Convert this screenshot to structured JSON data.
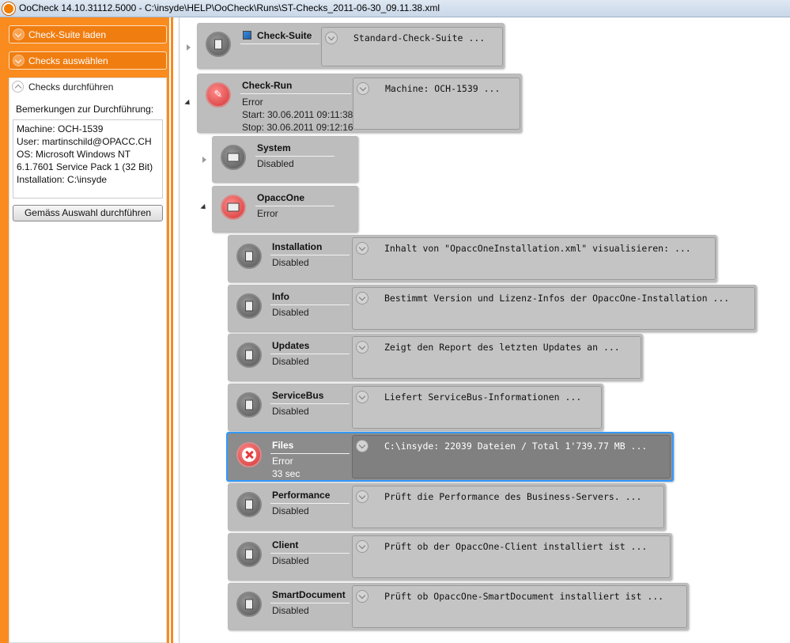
{
  "window": {
    "title": "OoCheck 14.10.31112.5000 - C:\\insyde\\HELP\\OoCheck\\Runs\\ST-Checks_2011-06-30_09.11.38.xml"
  },
  "sidebar": {
    "load_suite": "Check-Suite laden",
    "select_checks": "Checks auswählen",
    "run_checks": "Checks durchführen",
    "remarks_label": "Bemerkungen zur Durchführung:",
    "remarks_lines": [
      "Machine: OCH-1539",
      "User: martinschild@OPACC.CH",
      "OS: Microsoft Windows NT",
      "6.1.7601 Service Pack 1 (32 Bit)",
      "Installation: C:\\insyde"
    ],
    "run_button": "Gemäss Auswahl durchführen"
  },
  "tree": {
    "suite": {
      "name": "Check-Suite",
      "desc": "Standard-Check-Suite ..."
    },
    "run": {
      "name": "Check-Run",
      "status": "Error",
      "start": "Start: 30.06.2011 09:11:38",
      "stop": "Stop: 30.06.2011 09:12:16",
      "desc": "Machine: OCH-1539 ..."
    },
    "system": {
      "name": "System",
      "status": "Disabled"
    },
    "opaccone": {
      "name": "OpaccOne",
      "status": "Error"
    },
    "checks": [
      {
        "name": "Installation",
        "status": "Disabled",
        "desc": "Inhalt von \"OpaccOneInstallation.xml\" visualisieren: ..."
      },
      {
        "name": "Info",
        "status": "Disabled",
        "desc": "Bestimmt Version und Lizenz-Infos der OpaccOne-Installation ..."
      },
      {
        "name": "Updates",
        "status": "Disabled",
        "desc": "Zeigt den Report des letzten Updates an ..."
      },
      {
        "name": "ServiceBus",
        "status": "Disabled",
        "desc": "Liefert ServiceBus-Informationen ..."
      },
      {
        "name": "Files",
        "status": "Error",
        "duration": "33 sec",
        "desc": "C:\\insyde: 22039 Dateien / Total 1'739.77 MB ..."
      },
      {
        "name": "Performance",
        "status": "Disabled",
        "desc": "Prüft die Performance des Business-Servers. ..."
      },
      {
        "name": "Client",
        "status": "Disabled",
        "desc": "Prüft ob der OpaccOne-Client installiert ist ..."
      },
      {
        "name": "SmartDocument",
        "status": "Disabled",
        "desc": "Prüft ob OpaccOne-SmartDocument installiert ist ..."
      }
    ]
  },
  "colors": {
    "accent": "#f9891f",
    "selection": "#3399ff",
    "error": "#d33636"
  }
}
